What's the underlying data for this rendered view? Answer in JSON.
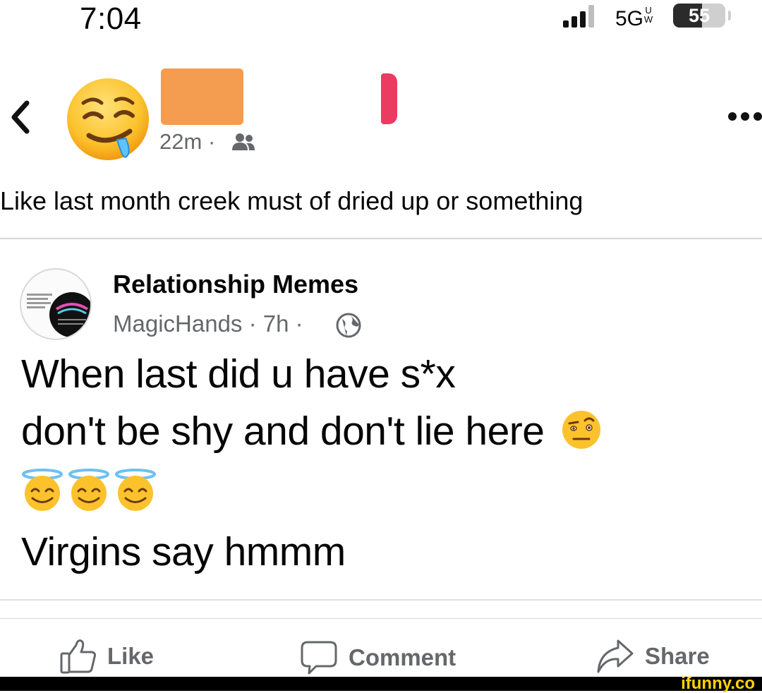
{
  "status_bar": {
    "time": "7:04",
    "network": "5G",
    "network_sub": "UW",
    "battery": "55",
    "battery_level": 0.55
  },
  "post": {
    "time_ago": "22m",
    "dot": "·",
    "audience_icon": "friends-icon",
    "caption": "Like last month  creek must of dried  up or something"
  },
  "shared": {
    "page_name": "Relationship Memes",
    "author": "MagicHands",
    "time_ago": "7h",
    "dot": "·",
    "audience_icon": "globe-icon",
    "line1": "When last did u have s*x",
    "line2": "don't be shy and don't lie here",
    "line4": "Virgins say hmmm",
    "emoji_raised_eyebrow": "face-with-raised-eyebrow",
    "emoji_halo": [
      "smiling-face-with-halo",
      "smiling-face-with-halo",
      "smiling-face-with-halo"
    ]
  },
  "actions": {
    "like": "Like",
    "comment": "Comment",
    "share": "Share"
  },
  "watermark": "ifunny.co",
  "colors": {
    "meta": "#65676b",
    "redact_orange": "#f49c4f",
    "redact_red": "#ec3b61",
    "watermark": "#ffd400"
  }
}
